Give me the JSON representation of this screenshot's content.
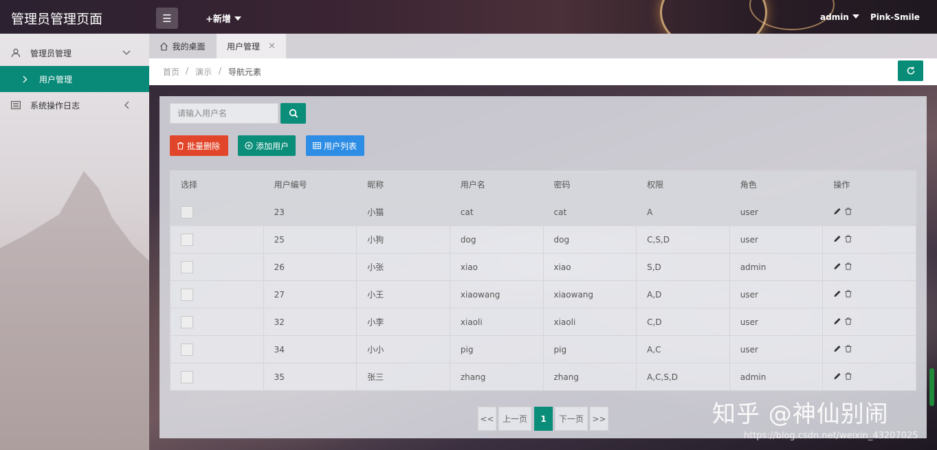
{
  "header": {
    "title": "管理员管理页面",
    "new_label": "+新增",
    "user_menu": "admin",
    "user_name": "Pink-Smile"
  },
  "sidebar": {
    "items": [
      {
        "label": "管理员管理",
        "icon": "user-icon",
        "expanded": true
      },
      {
        "label": "系统操作日志",
        "icon": "list-icon",
        "expanded": false
      }
    ],
    "sub_items": [
      {
        "label": "用户管理",
        "active": true
      }
    ]
  },
  "tabs": [
    {
      "label": "我的桌面",
      "icon": "home-icon"
    },
    {
      "label": "用户管理",
      "closable": true
    }
  ],
  "breadcrumb": [
    "首页",
    "演示",
    "导航元素"
  ],
  "search": {
    "placeholder": "请输入用户名",
    "value": ""
  },
  "actions": {
    "batch_delete": "批量删除",
    "add_user": "添加用户",
    "user_list": "用户列表"
  },
  "table": {
    "headers": [
      "选择",
      "用户编号",
      "昵称",
      "用户名",
      "密码",
      "权限",
      "角色",
      "操作"
    ],
    "rows": [
      {
        "id": "23",
        "nickname": "小猫",
        "username": "cat",
        "password": "cat",
        "perm": "A",
        "role": "user"
      },
      {
        "id": "25",
        "nickname": "小狗",
        "username": "dog",
        "password": "dog",
        "perm": "C,S,D",
        "role": "user"
      },
      {
        "id": "26",
        "nickname": "小张",
        "username": "xiao",
        "password": "xiao",
        "perm": "S,D",
        "role": "admin"
      },
      {
        "id": "27",
        "nickname": "小王",
        "username": "xiaowang",
        "password": "xiaowang",
        "perm": "A,D",
        "role": "user"
      },
      {
        "id": "32",
        "nickname": "小李",
        "username": "xiaoli",
        "password": "xiaoli",
        "perm": "C,D",
        "role": "user"
      },
      {
        "id": "34",
        "nickname": "小小",
        "username": "pig",
        "password": "pig",
        "perm": "A,C",
        "role": "user"
      },
      {
        "id": "35",
        "nickname": "张三",
        "username": "zhang",
        "password": "zhang",
        "perm": "A,C,S,D",
        "role": "admin"
      }
    ]
  },
  "pagination": {
    "first": "<<",
    "prev": "上一页",
    "current": "1",
    "next": "下一页",
    "last": ">>"
  },
  "watermark": {
    "text": "知乎 @神仙别闹",
    "url": "https://blog.csdn.net/weixin_43207025"
  },
  "colors": {
    "primary": "#098977",
    "danger": "#e1462a",
    "info": "#2d8ce3"
  }
}
